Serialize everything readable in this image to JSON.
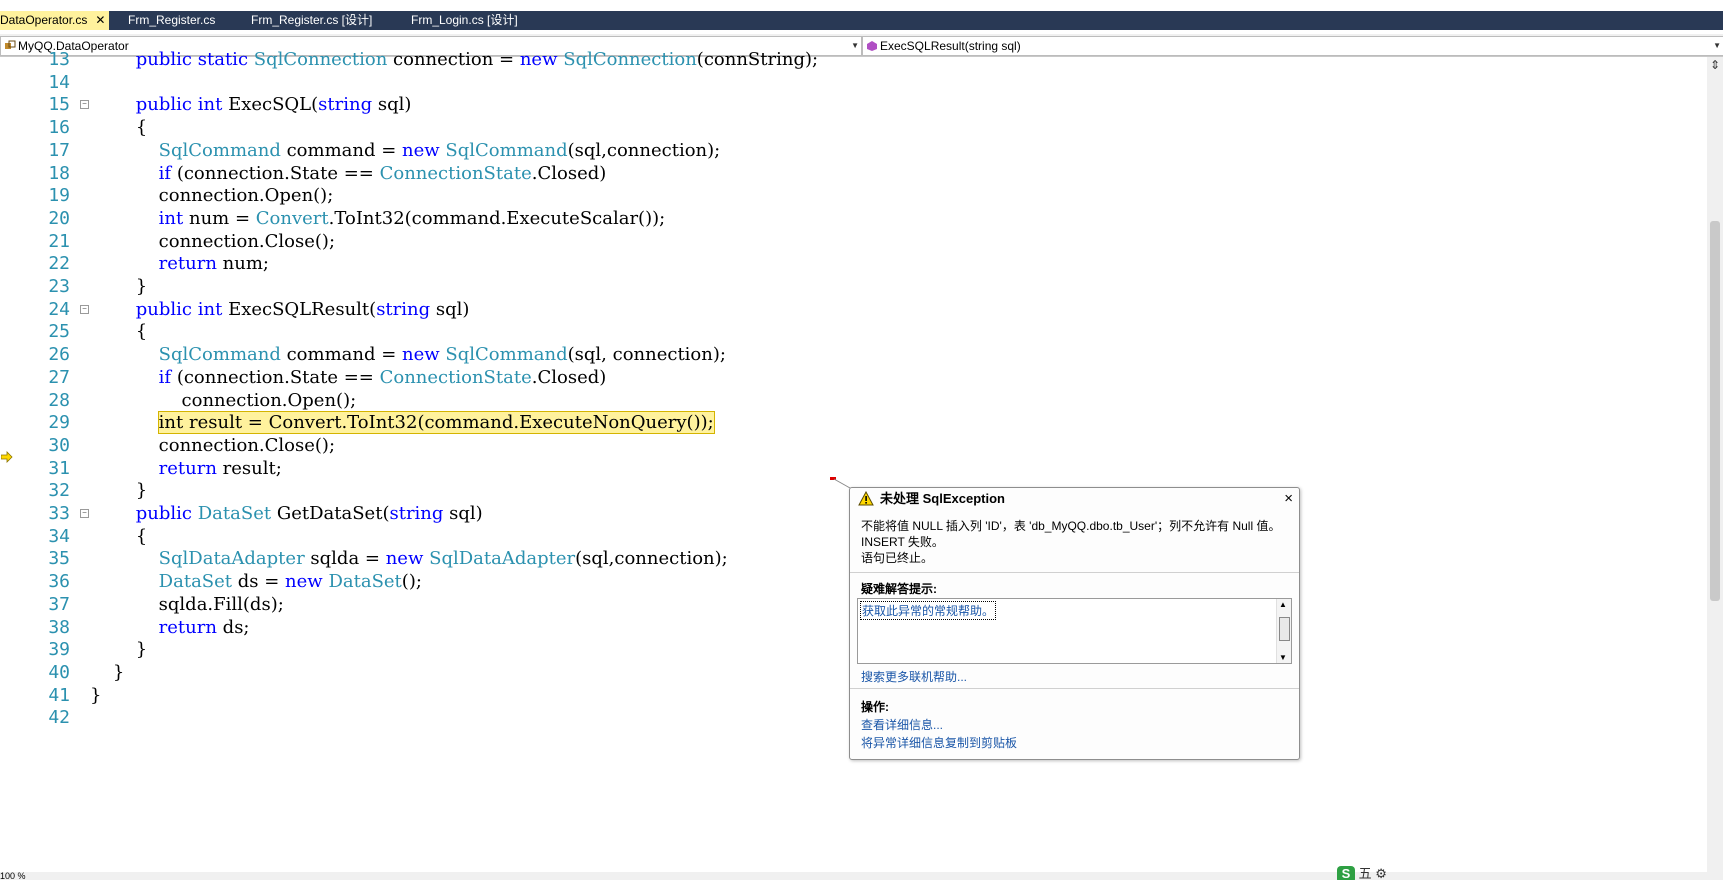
{
  "tabs": [
    {
      "label": "DataOperator.cs",
      "active": true
    },
    {
      "label": "Frm_Register.cs"
    },
    {
      "label": "Frm_Register.cs [设计]"
    },
    {
      "label": "Frm_Login.cs [设计]"
    }
  ],
  "nav": {
    "type_combo": "MyQQ.DataOperator",
    "member_combo": "ExecSQLResult(string sql)"
  },
  "code_lines": [
    {
      "n": "13",
      "text": "        public static SqlConnection connection = new SqlConnection(connString);"
    },
    {
      "n": "14",
      "text": ""
    },
    {
      "n": "15",
      "text": "        public int ExecSQL(string sql)"
    },
    {
      "n": "16",
      "text": "        {"
    },
    {
      "n": "17",
      "text": "            SqlCommand command = new SqlCommand(sql,connection);"
    },
    {
      "n": "18",
      "text": "            if (connection.State == ConnectionState.Closed)"
    },
    {
      "n": "19",
      "text": "            connection.Open();"
    },
    {
      "n": "20",
      "text": "            int num = Convert.ToInt32(command.ExecuteScalar());"
    },
    {
      "n": "21",
      "text": "            connection.Close();"
    },
    {
      "n": "22",
      "text": "            return num;"
    },
    {
      "n": "23",
      "text": "        }"
    },
    {
      "n": "24",
      "text": "        public int ExecSQLResult(string sql)"
    },
    {
      "n": "25",
      "text": "        {"
    },
    {
      "n": "26",
      "text": "            SqlCommand command = new SqlCommand(sql, connection);"
    },
    {
      "n": "27",
      "text": "            if (connection.State == ConnectionState.Closed)"
    },
    {
      "n": "28",
      "text": "                connection.Open();"
    },
    {
      "n": "29",
      "text": "            int result = Convert.ToInt32(command.ExecuteNonQuery());"
    },
    {
      "n": "30",
      "text": "            connection.Close();"
    },
    {
      "n": "31",
      "text": "            return result;"
    },
    {
      "n": "32",
      "text": "        }"
    },
    {
      "n": "33",
      "text": "        public DataSet GetDataSet(string sql)"
    },
    {
      "n": "34",
      "text": "        {"
    },
    {
      "n": "35",
      "text": "            SqlDataAdapter sqlda = new SqlDataAdapter(sql,connection);"
    },
    {
      "n": "36",
      "text": "            DataSet ds = new DataSet();"
    },
    {
      "n": "37",
      "text": "            sqlda.Fill(ds);"
    },
    {
      "n": "38",
      "text": "            return ds;"
    },
    {
      "n": "39",
      "text": "        }"
    },
    {
      "n": "40",
      "text": "    }"
    },
    {
      "n": "41",
      "text": "}"
    },
    {
      "n": "42",
      "text": ""
    }
  ],
  "highlighted_line": "29",
  "popup": {
    "title": "未处理 SqlException",
    "close": "×",
    "message": "不能将值 NULL 插入列 'ID'，表 'db_MyQQ.dbo.tb_User'；列不允许有 Null 值。INSERT 失败。",
    "message2": "语句已终止。",
    "tips_heading": "疑难解答提示:",
    "tip_link": "获取此异常的常规帮助。",
    "search_link": "搜索更多联机帮助...",
    "actions_heading": "操作:",
    "action_details": "查看详细信息...",
    "action_copy": "将异常详细信息复制到剪贴板"
  },
  "status": {
    "zoom": "100 %",
    "ime": "五"
  },
  "colors": {
    "tab_bar": "#293955",
    "active_tab": "#fff29d",
    "keyword": "#0000ff",
    "type": "#2b91af",
    "highlight": "#fff29d"
  }
}
